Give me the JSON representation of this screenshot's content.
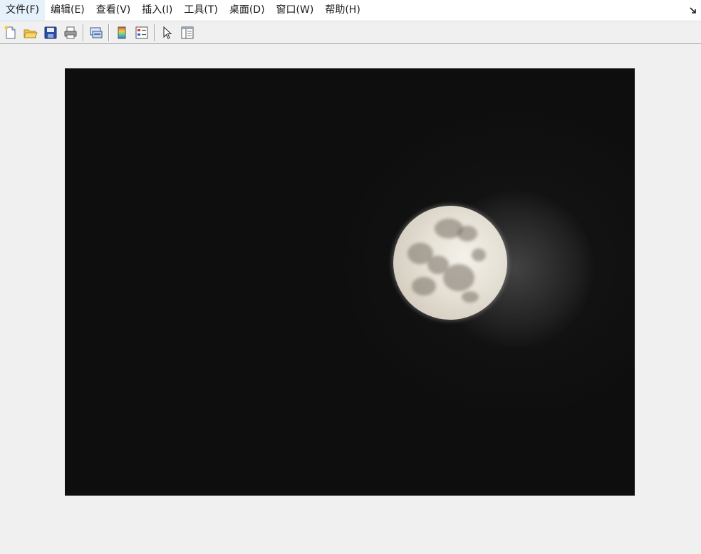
{
  "menubar": {
    "items": [
      {
        "label": "文件(F)"
      },
      {
        "label": "编辑(E)"
      },
      {
        "label": "查看(V)"
      },
      {
        "label": "插入(I)"
      },
      {
        "label": "工具(T)"
      },
      {
        "label": "桌面(D)"
      },
      {
        "label": "窗口(W)"
      },
      {
        "label": "帮助(H)"
      }
    ],
    "corner_icon": "dock-arrow-icon"
  },
  "toolbar": {
    "buttons": [
      {
        "icon": "new-figure-icon"
      },
      {
        "icon": "open-file-icon"
      },
      {
        "icon": "save-icon"
      },
      {
        "icon": "print-icon"
      },
      {
        "icon": "link-plot-icon"
      },
      {
        "icon": "colorbar-icon"
      },
      {
        "icon": "legend-icon"
      },
      {
        "icon": "edit-plot-pointer-icon"
      },
      {
        "icon": "property-inspector-icon"
      }
    ]
  },
  "figure": {
    "content": "full-moon-image",
    "background_color": "#f0f0f0",
    "image_background": "#0e0e0e"
  }
}
